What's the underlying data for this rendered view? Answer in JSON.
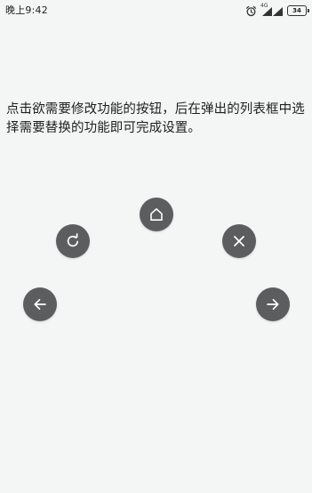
{
  "status_bar": {
    "time": "晚上9:42",
    "network_label": "4G",
    "battery_level": "34",
    "icons": [
      "alarm-icon",
      "signal-icon",
      "battery-icon"
    ]
  },
  "instruction": "点击欲需要修改功能的按钮，后在弹出的列表框中选择需要替换的功能即可完成设置。",
  "buttons": {
    "home": {
      "icon": "home-icon"
    },
    "refresh": {
      "icon": "refresh-icon"
    },
    "close": {
      "icon": "close-icon"
    },
    "back": {
      "icon": "arrow-left-icon"
    },
    "forward": {
      "icon": "arrow-right-icon"
    }
  },
  "colors": {
    "background": "#f4f6f6",
    "button": "#5b5d5f",
    "icon": "#ffffff",
    "text": "#1e1e1e"
  }
}
